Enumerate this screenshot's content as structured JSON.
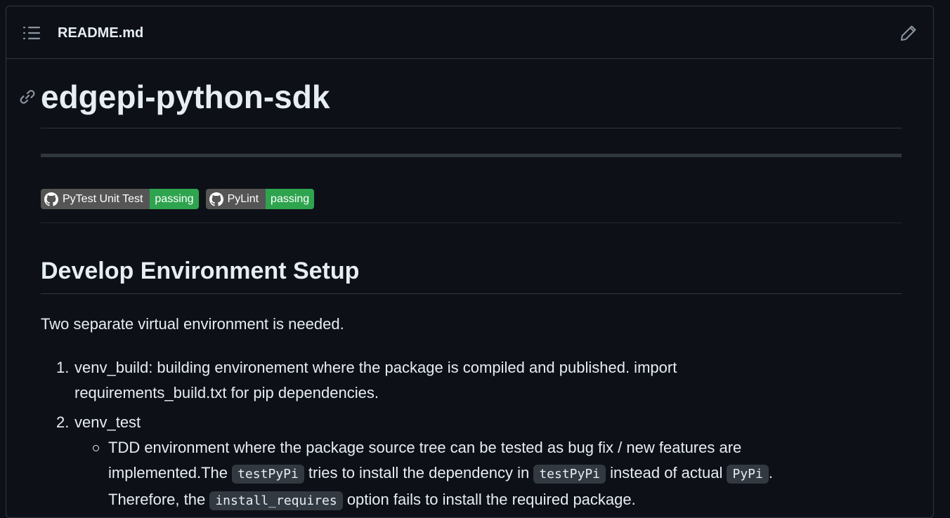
{
  "header": {
    "file_name": "README.md",
    "toc_icon": "list-unordered-icon",
    "edit_icon": "pencil-icon"
  },
  "readme": {
    "title": "edgepi-python-sdk",
    "anchor_icon": "link-icon",
    "badges": [
      {
        "label": "PyTest Unit Test",
        "status": "passing",
        "icon": "github-icon"
      },
      {
        "label": "PyLint",
        "status": "passing",
        "icon": "github-icon"
      }
    ],
    "section_title": "Develop Environment Setup",
    "intro": "Two separate virtual environment is needed.",
    "list": [
      {
        "num": "1.",
        "line1": "venv_build: building environement where the package is compiled and published. import",
        "line2": "requirements_build.txt for pip dependencies."
      },
      {
        "num": "2.",
        "line1": "venv_test",
        "sub": {
          "l1": "TDD environment where the package source tree can be tested as bug fix / new features are",
          "l2a": "implemented.The ",
          "code1": "testPyPi",
          "l2b": " tries to install the dependency in ",
          "code2": "testPyPi",
          "l2c": " instead of actual ",
          "code3": "PyPi",
          "l2d": ".",
          "l3a": "Therefore, the ",
          "code4": "install_requires",
          "l3b": " option fails to install the required package."
        }
      }
    ]
  },
  "colors": {
    "background": "#0d1117",
    "border": "#30363d",
    "text": "#e6edf3",
    "badge_left": "#555555",
    "badge_passing": "#2ea44f"
  }
}
